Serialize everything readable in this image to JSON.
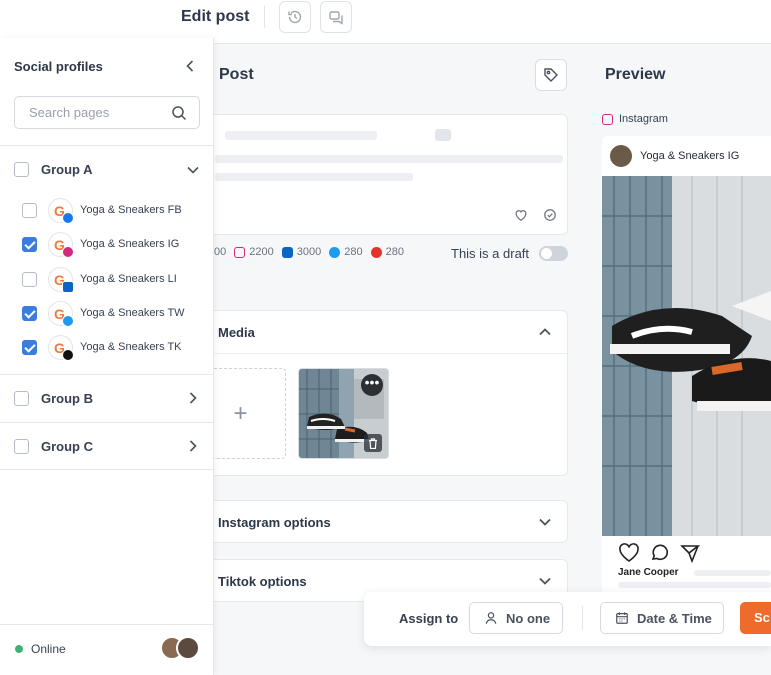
{
  "topbar": {
    "title": "Edit post"
  },
  "post": {
    "header": "Post",
    "counts": [
      {
        "network": "facebook",
        "value": "00",
        "color": "#1877f2"
      },
      {
        "network": "instagram",
        "value": "2200",
        "color": "#d6287d"
      },
      {
        "network": "linkedin",
        "value": "3000",
        "color": "#0a66c2"
      },
      {
        "network": "twitter",
        "value": "280",
        "color": "#1d9bf0"
      },
      {
        "network": "tiktok",
        "value": "280",
        "color": "#e5322b"
      }
    ],
    "draft_label": "This is a draft",
    "media_title": "Media",
    "add_media_symbol": "+",
    "instagram_options": "Instagram options",
    "tiktok_options": "Tiktok options"
  },
  "preview": {
    "title": "Preview",
    "network_label": "Instagram",
    "account_name": "Yoga & Sneakers IG",
    "commenter": "Jane Cooper"
  },
  "sidebar": {
    "title": "Social profiles",
    "search_placeholder": "Search pages",
    "groups": [
      {
        "label": "Group A",
        "checked": false,
        "expanded": true,
        "pages": [
          {
            "label": "Yoga & Sneakers FB",
            "checked": false,
            "network": "facebook",
            "color": "#1877f2"
          },
          {
            "label": "Yoga & Sneakers IG",
            "checked": true,
            "network": "instagram",
            "color": "#d6287d"
          },
          {
            "label": "Yoga & Sneakers LI",
            "checked": false,
            "network": "linkedin",
            "color": "#0a66c2"
          },
          {
            "label": "Yoga & Sneakers TW",
            "checked": true,
            "network": "twitter",
            "color": "#1d9bf0"
          },
          {
            "label": "Yoga & Sneakers TK",
            "checked": true,
            "network": "tiktok",
            "color": "#111111"
          }
        ]
      },
      {
        "label": "Group B",
        "checked": false,
        "expanded": false
      },
      {
        "label": "Group C",
        "checked": false,
        "expanded": false
      }
    ],
    "status": "Online"
  },
  "bottombar": {
    "assign_label": "Assign to",
    "assignee": "No one",
    "datetime": "Date & Time",
    "schedule": "Sc"
  },
  "colors": {
    "accent": "#3b7ddd",
    "schedule": "#ef6b2c",
    "online": "#3cb371"
  }
}
